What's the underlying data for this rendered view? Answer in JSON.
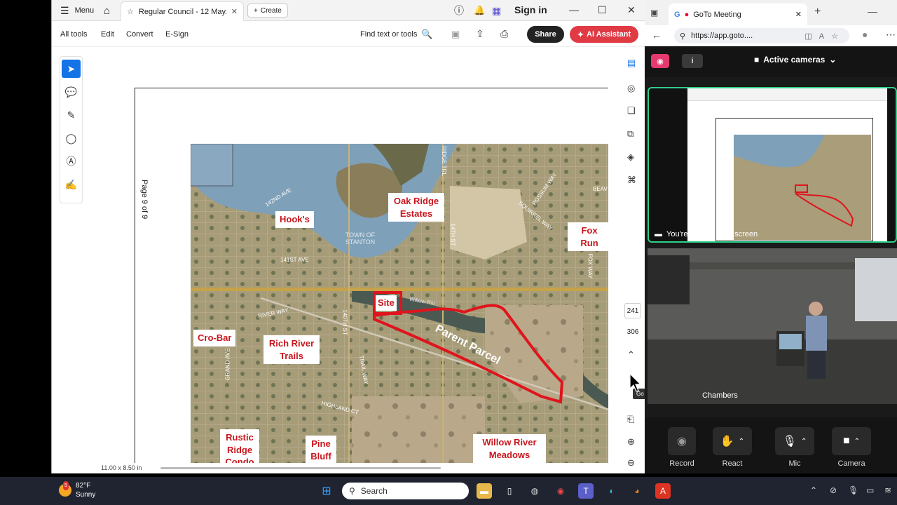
{
  "acrobat": {
    "menu_label": "Menu",
    "tab_title": "Regular Council - 12 May...",
    "create_label": "Create",
    "signin_label": "Sign in",
    "menubar": [
      "All tools",
      "Edit",
      "Convert",
      "E-Sign"
    ],
    "find_label": "Find text or tools",
    "share_label": "Share",
    "ai_label": "AI Assistant",
    "page_label": "Page 9 of 9",
    "page_number": "241",
    "page_total": "306",
    "page_size": "11.00 x 8.50 in",
    "tooltip": "Go to next page (→)"
  },
  "map": {
    "labels": {
      "hooks": "Hook's",
      "oak_ridge": "Oak Ridge Estates",
      "fox_run": "Fox Run",
      "site": "Site",
      "cro_bar": "Cro-Bar",
      "rich_river": "Rich River Trails",
      "rustic_ridge": "Rustic Ridge Condo",
      "pine_bluff": "Pine Bluff",
      "willow_meadows": "Willow River Meadows"
    },
    "parent_parcel": "Parent Parcel",
    "town_label": "TOWN OF STANTON",
    "streets": [
      "142ND AVE",
      "141ST AVE",
      "RIVER WAY",
      "140TH ST",
      "GRAND AVE",
      "HIGHLAND CT",
      "POSSUM WAY",
      "SQUIRREL WAY",
      "RIDGE TRL",
      "FOX WAY",
      "Willow Riv",
      "14TH ST",
      "TRAIL WAY",
      "BEAV"
    ]
  },
  "browser": {
    "tab_title": "GoTo Meeting",
    "url": "https://app.goto...."
  },
  "goto": {
    "cameras_label": "Active cameras",
    "sharing_label": "You're sharing your screen",
    "camera_label": "Chambers",
    "controls": [
      "Record",
      "React",
      "Mic",
      "Camera"
    ]
  },
  "taskbar": {
    "temp": "82°F",
    "condition": "Sunny",
    "badge": "5",
    "search_placeholder": "Search"
  },
  "colors": {
    "accent_red": "#c8161d",
    "acrobat_ai": "#e03b45",
    "acrobat_blue": "#1473e6",
    "goto_green": "#2fd08a",
    "goto_pink": "#e63a6e"
  }
}
